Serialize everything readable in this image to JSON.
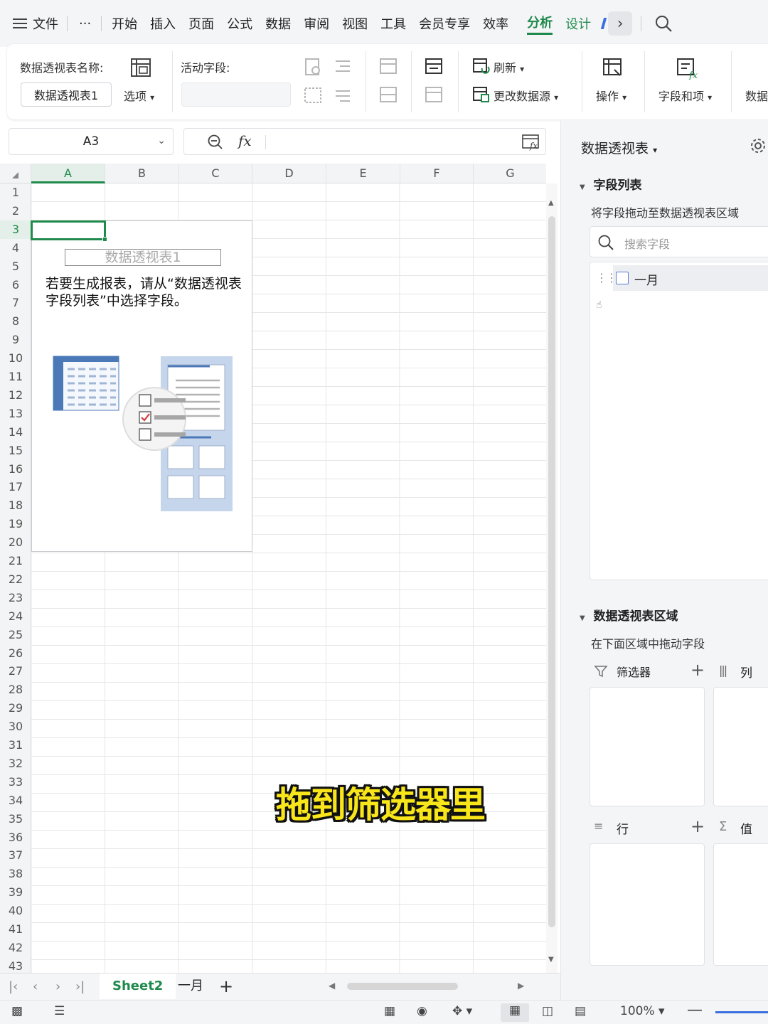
{
  "menubar": {
    "file": "文件",
    "more": "···",
    "tabs": [
      "开始",
      "插入",
      "页面",
      "公式",
      "数据",
      "审阅",
      "视图",
      "工具",
      "会员专享",
      "效率"
    ],
    "active_tab": "分析",
    "design_tab": "设计"
  },
  "ribbon": {
    "pivot_name_label": "数据透视表名称:",
    "pivot_name_value": "数据透视表1",
    "options_label": "选项",
    "active_field_label": "活动字段:",
    "refresh_label": "刷新",
    "change_source_label": "更改数据源",
    "operate_label": "操作",
    "fields_items_label": "字段和项",
    "data_label": "数据"
  },
  "formula": {
    "cell_ref": "A3",
    "fx": "fx"
  },
  "grid": {
    "columns": [
      "A",
      "B",
      "C",
      "D",
      "E",
      "F",
      "G"
    ],
    "rows": [
      "1",
      "2",
      "3",
      "4",
      "5",
      "6",
      "7",
      "8",
      "9",
      "10",
      "11",
      "12",
      "13",
      "14",
      "15",
      "16",
      "17",
      "18",
      "19",
      "20",
      "21",
      "22",
      "23",
      "24",
      "25",
      "26",
      "27",
      "28",
      "29",
      "30",
      "31",
      "32",
      "33",
      "34",
      "35",
      "36",
      "37",
      "38",
      "39",
      "40",
      "41",
      "42",
      "43"
    ],
    "selected_row": "3",
    "selected_col": "A",
    "pivot_title": "数据透视表1",
    "pivot_message": "若要生成报表，请从“数据透视表字段列表”中选择字段。"
  },
  "pane": {
    "title": "数据透视表",
    "field_list_label": "字段列表",
    "drag_hint": "将字段拖动至数据透视表区域",
    "search_placeholder": "搜索字段",
    "fields": [
      {
        "name": "一月",
        "checked": false
      }
    ],
    "areas_label": "数据透视表区域",
    "areas_hint": "在下面区域中拖动字段",
    "filter_label": "筛选器",
    "column_label": "列",
    "row_label": "行",
    "value_label": "值"
  },
  "sheets": {
    "tabs": [
      "Sheet2",
      "一月"
    ],
    "active": "Sheet2"
  },
  "status": {
    "zoom": "100%"
  },
  "caption": "拖到筛选器里",
  "colors": {
    "accent": "#1f8a4c",
    "caption": "#f9e61a"
  }
}
